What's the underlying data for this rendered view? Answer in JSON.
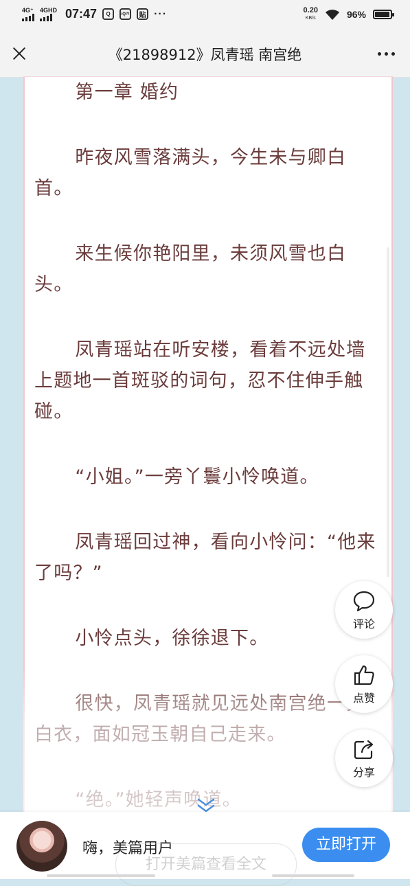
{
  "status_bar": {
    "signal1_label": "4G⁺",
    "signal2_label": "4GHD",
    "time": "07:47",
    "app_icon_1": "Q",
    "app_icon_2": "iQIY",
    "app_icon_3": "贴",
    "more_dots": "···",
    "net_speed": "0.20",
    "net_unit": "KB/s",
    "battery": "96%",
    "battery_level": 0.96
  },
  "nav": {
    "title": "《21898912》凤青瑶 南宫绝"
  },
  "article": {
    "heading": "第一章 婚约",
    "paragraphs": [
      "昨夜风雪落满头，今生未与卿白首。",
      "来生候你艳阳里，未须风雪也白头。",
      "凤青瑶站在听安楼，看着不远处墙上题地一首斑驳的词句，忍不住伸手触碰。",
      "“小姐。”一旁丫鬟小怜唤道。",
      "凤青瑶回过神，看向小怜问：“他来了吗？”",
      "小怜点头，徐徐退下。",
      "很快，凤青瑶就见远处南宫绝一身白衣，面如冠玉朝自己走来。",
      "“绝。”她轻声唤道。"
    ]
  },
  "actions": {
    "comment": "评论",
    "like": "点赞",
    "share": "分享"
  },
  "bottom": {
    "greeting": "嗨，美篇用户",
    "open_button": "立即打开",
    "read_full": "打开美篇查看全文"
  }
}
